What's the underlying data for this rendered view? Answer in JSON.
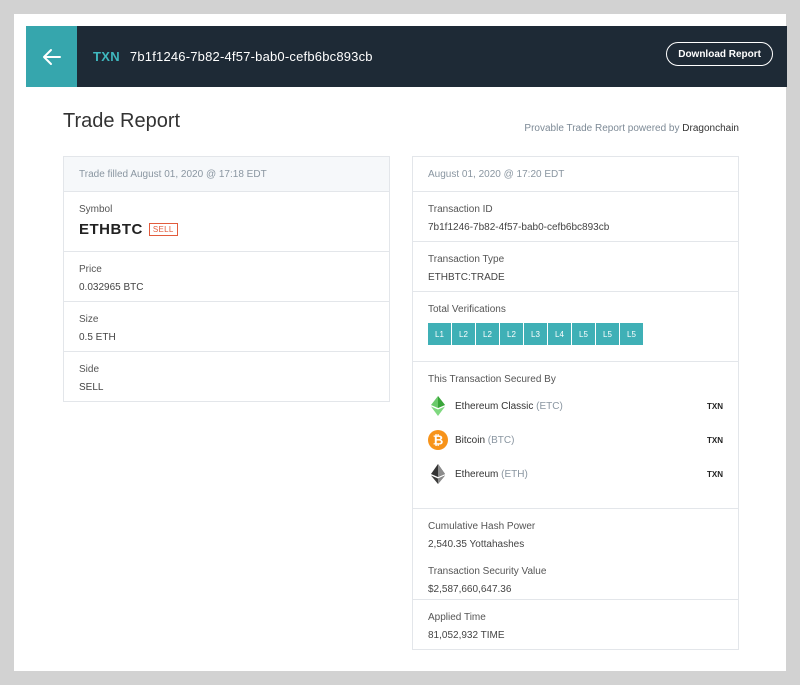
{
  "header": {
    "txn_label": "TXN",
    "txn_id": "7b1f1246-7b82-4f57-bab0-cefb6bc893cb",
    "download_label": "Download Report"
  },
  "page": {
    "title": "Trade Report",
    "powered_prefix": "Provable Trade Report powered by",
    "powered_brand": "Dragonchain"
  },
  "trade": {
    "header": "Trade filled August 01, 2020 @ 17:18 EDT",
    "symbol_label": "Symbol",
    "symbol": "ETHBTC",
    "symbol_badge": "SELL",
    "price_label": "Price",
    "price": "0.032965 BTC",
    "size_label": "Size",
    "size": "0.5 ETH",
    "side_label": "Side",
    "side": "SELL"
  },
  "transaction": {
    "header": "August 01, 2020 @ 17:20 EDT",
    "id_label": "Transaction ID",
    "id": "7b1f1246-7b82-4f57-bab0-cefb6bc893cb",
    "type_label": "Transaction Type",
    "type": "ETHBTC:TRADE",
    "verifications_label": "Total Verifications",
    "verifications": [
      "L1",
      "L2",
      "L2",
      "L2",
      "L3",
      "L4",
      "L5",
      "L5",
      "L5"
    ],
    "secured_label": "This Transaction Secured By",
    "chains": [
      {
        "name": "Ethereum Classic",
        "ticker": "(ETC)",
        "link": "TXN",
        "icon": "ethereum-classic-icon",
        "color": "#3ab83a"
      },
      {
        "name": "Bitcoin",
        "ticker": "(BTC)",
        "link": "TXN",
        "icon": "bitcoin-icon",
        "color": "#f7931a"
      },
      {
        "name": "Ethereum",
        "ticker": "(ETH)",
        "link": "TXN",
        "icon": "ethereum-icon",
        "color": "#343434"
      }
    ],
    "hash_power_label": "Cumulative Hash Power",
    "hash_power": "2,540.35 Yottahashes",
    "security_value_label": "Transaction Security Value",
    "security_value": "$2,587,660,647.36",
    "applied_time_label": "Applied Time",
    "applied_time": "81,052,932 TIME"
  },
  "colors": {
    "accent": "#36a6ad",
    "header_bg": "#1e2a36",
    "sell": "#e25b3c"
  }
}
